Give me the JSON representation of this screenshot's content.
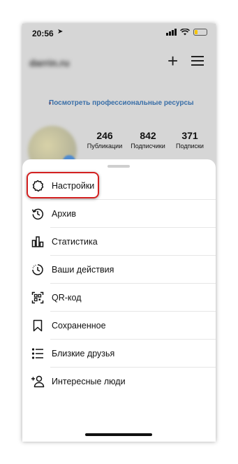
{
  "status_bar": {
    "time": "20:56",
    "location_arrow": "location-arrow-icon",
    "battery_color": "#f5c400"
  },
  "profile": {
    "username": "darrin.ru",
    "resources_link": "Посмотреть профессиональные ресурсы",
    "stats": [
      {
        "value": "246",
        "label": "Публикации"
      },
      {
        "value": "842",
        "label": "Подписчики"
      },
      {
        "value": "371",
        "label": "Подписки"
      }
    ]
  },
  "menu": {
    "items": [
      {
        "label": "Настройки",
        "icon": "settings-gear-icon"
      },
      {
        "label": "Архив",
        "icon": "archive-history-icon"
      },
      {
        "label": "Статистика",
        "icon": "bar-chart-icon"
      },
      {
        "label": "Ваши действия",
        "icon": "activity-clock-icon"
      },
      {
        "label": "QR-код",
        "icon": "qr-code-icon"
      },
      {
        "label": "Сохраненное",
        "icon": "bookmark-icon"
      },
      {
        "label": "Близкие друзья",
        "icon": "close-friends-list-icon"
      },
      {
        "label": "Интересные люди",
        "icon": "add-person-icon"
      }
    ]
  },
  "highlight_color": "#d32020"
}
